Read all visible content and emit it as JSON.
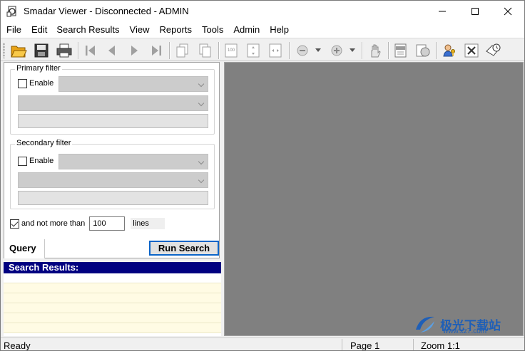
{
  "window": {
    "title": "Smadar Viewer - Disconnected - ADMIN",
    "controls": {
      "minimize": "minimize",
      "maximize": "maximize",
      "close": "close"
    }
  },
  "menu": [
    "File",
    "Edit",
    "Search Results",
    "View",
    "Reports",
    "Tools",
    "Admin",
    "Help"
  ],
  "toolbar": {
    "buttons": [
      "open-folder-icon",
      "save-icon",
      "print-icon",
      "first-page-icon",
      "previous-page-icon",
      "next-page-icon",
      "last-page-icon",
      "copy-page-icon",
      "paste-page-icon",
      "zoom-100-icon",
      "fit-page-icon",
      "fit-width-icon",
      "zoom-out-icon",
      "zoom-in-icon",
      "hand-pan-icon",
      "export-pdf-icon",
      "web-icon",
      "user-key-icon",
      "tools-icon",
      "scheduler-icon"
    ],
    "zoom_100_label": "100"
  },
  "filters": {
    "primary": {
      "title": "Primary filter",
      "enable_label": "Enable",
      "enabled": false
    },
    "secondary": {
      "title": "Secondary filter",
      "enable_label": "Enable",
      "enabled": false
    },
    "limit": {
      "label": "and not more than",
      "value": "100",
      "unit": "lines",
      "checked": true
    }
  },
  "query_tab": "Query",
  "run_button": "Run Search",
  "results": {
    "header": "Search Results:"
  },
  "status": {
    "ready": "Ready",
    "page": "Page 1",
    "zoom": "Zoom 1:1"
  },
  "watermark": {
    "text": "极光下载站",
    "url": "www.xz7.com"
  },
  "colors": {
    "results_header": "#000080",
    "preview_bg": "#808080",
    "run_border": "#0a64c8"
  }
}
